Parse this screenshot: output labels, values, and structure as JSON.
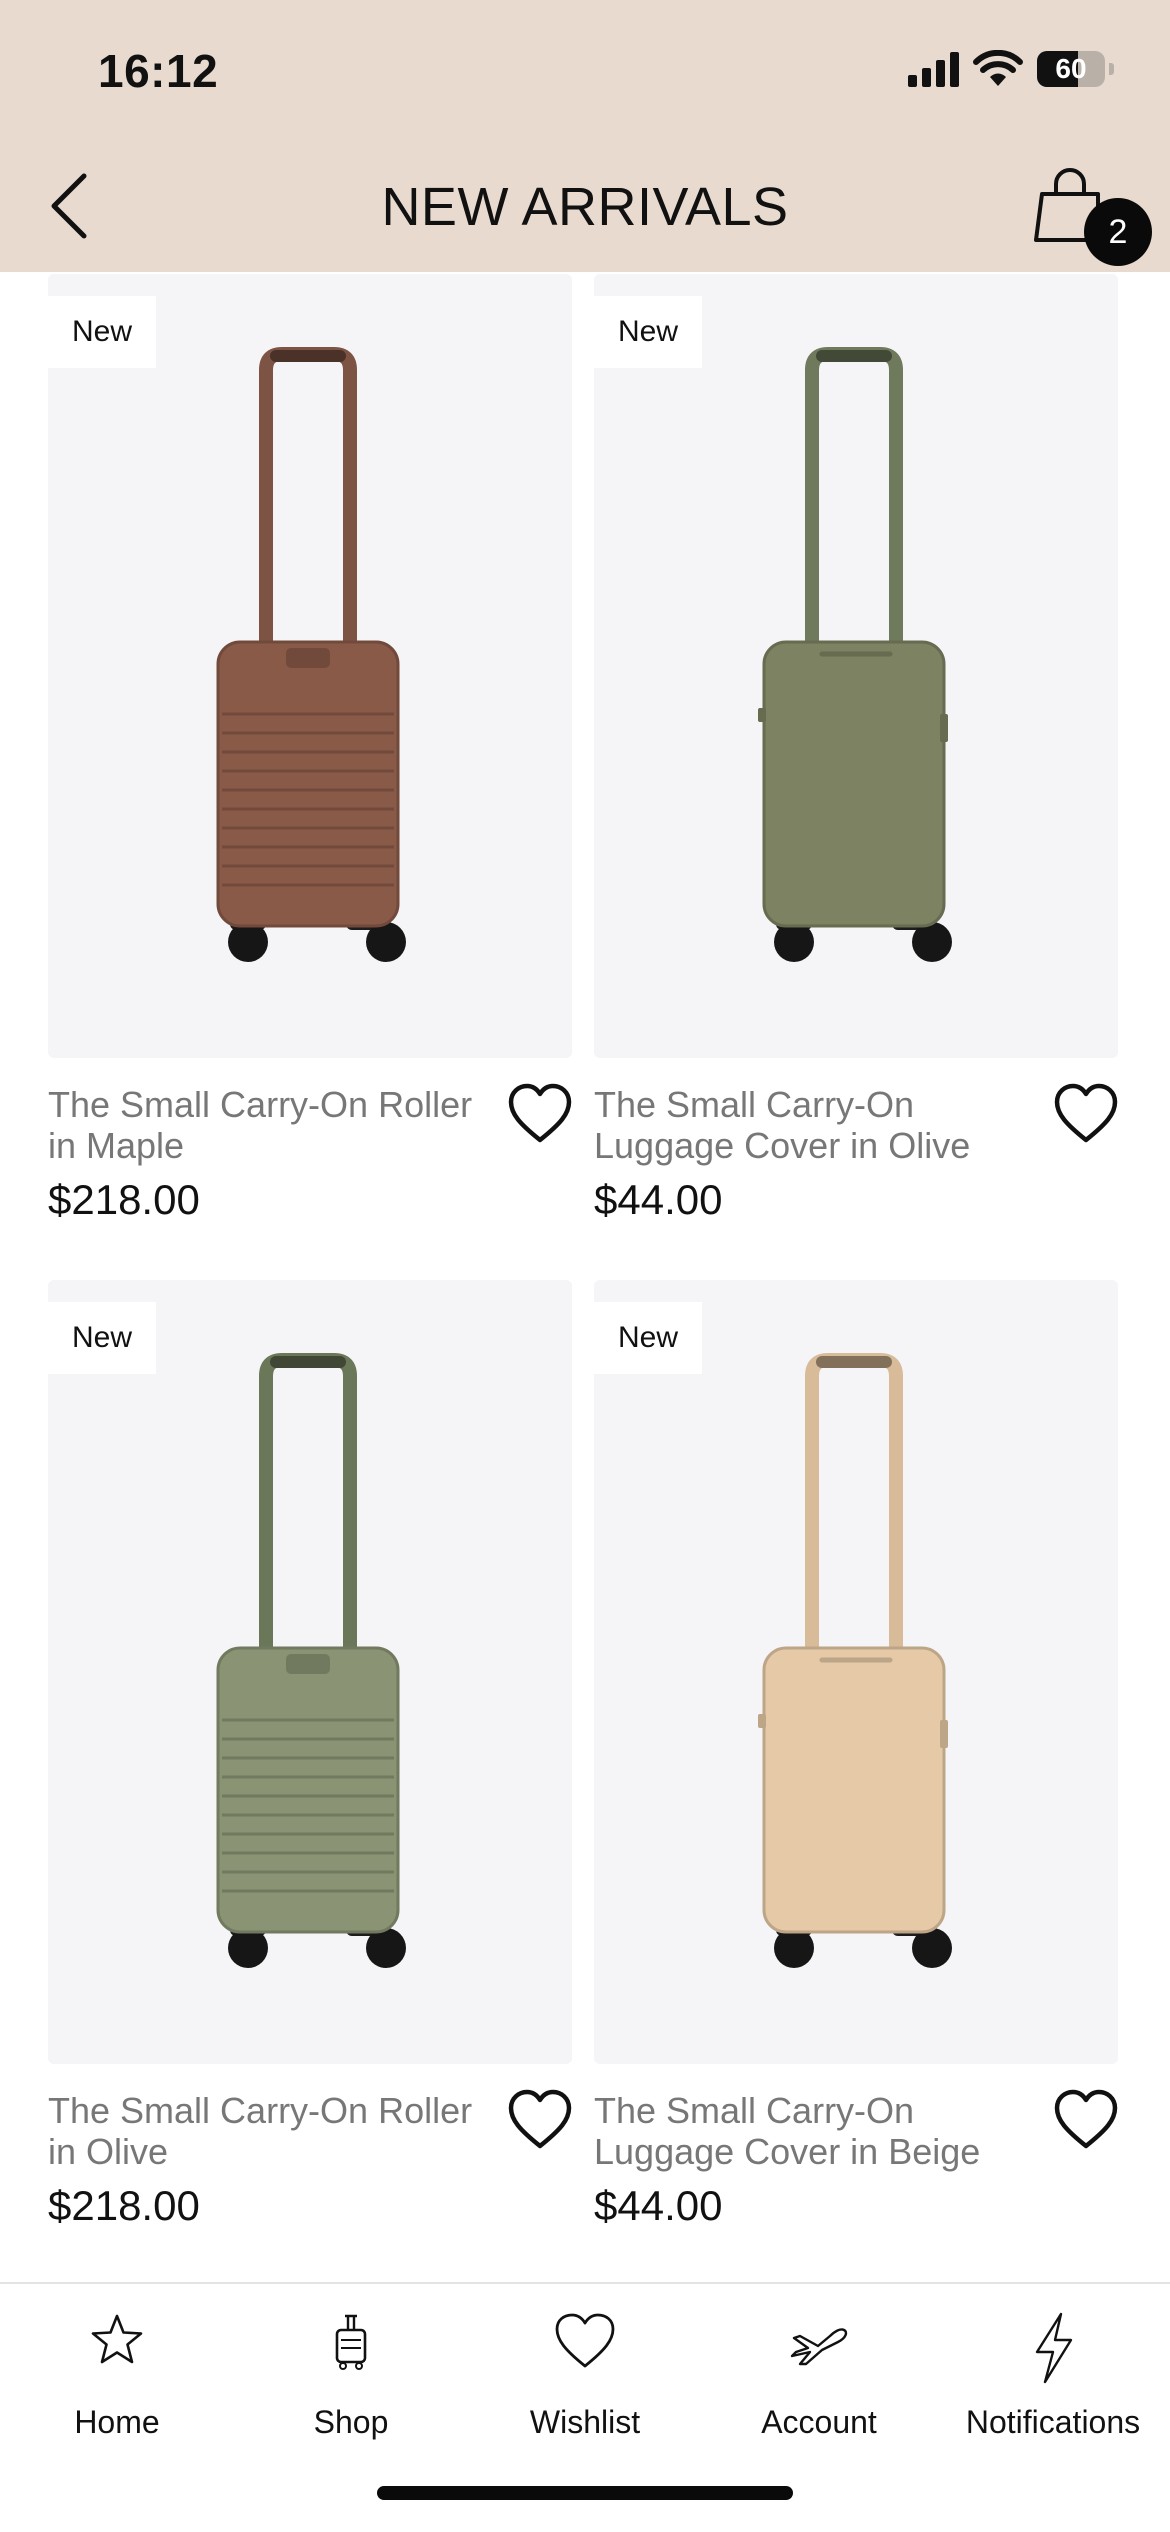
{
  "status_bar": {
    "time": "16:12",
    "battery_percent": "60",
    "battery_level": 0.6
  },
  "header": {
    "title": "NEW ARRIVALS",
    "cart_count": "2",
    "background": "#e8dace"
  },
  "products": [
    {
      "badge": "New",
      "name": "The Small Carry-On Roller in Maple",
      "price": "$218.00",
      "color": "#8a5a48",
      "handle_color": "#7d5444",
      "style": "roller"
    },
    {
      "badge": "New",
      "name": "The Small Carry-On Luggage Cover in Olive",
      "price": "$44.00",
      "color": "#7d8262",
      "handle_color": "#6f7a5c",
      "style": "cover"
    },
    {
      "badge": "New",
      "name": "The Small Carry-On Roller in Olive",
      "price": "$218.00",
      "color": "#8a9474",
      "handle_color": "#6a7758",
      "style": "roller"
    },
    {
      "badge": "New",
      "name": "The Small Carry-On Luggage Cover in Beige",
      "price": "$44.00",
      "color": "#e6c9a6",
      "handle_color": "#d8bb98",
      "style": "cover"
    }
  ],
  "tabbar": {
    "items": [
      {
        "label": "Home",
        "icon": "star-icon"
      },
      {
        "label": "Shop",
        "icon": "luggage-icon"
      },
      {
        "label": "Wishlist",
        "icon": "heart-icon"
      },
      {
        "label": "Account",
        "icon": "airplane-icon"
      },
      {
        "label": "Notifications",
        "icon": "lightning-icon"
      }
    ]
  }
}
